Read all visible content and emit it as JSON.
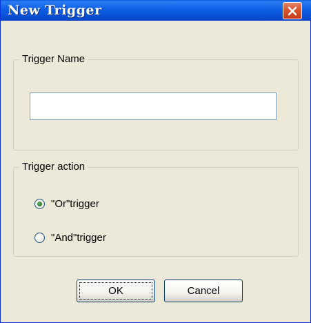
{
  "window": {
    "title": "New Trigger",
    "close_icon": "close-icon"
  },
  "trigger_name": {
    "group_label": "Trigger Name",
    "value": "",
    "placeholder": ""
  },
  "trigger_action": {
    "group_label": "Trigger action",
    "options": [
      {
        "label": "\"Or\"trigger",
        "selected": true
      },
      {
        "label": "\"And\"trigger",
        "selected": false
      }
    ]
  },
  "buttons": {
    "ok": "OK",
    "cancel": "Cancel"
  },
  "colors": {
    "titlebar": "#0A55D8",
    "close": "#D9532D",
    "face": "#ECE9D8",
    "radio_dot": "#2A7A2A"
  }
}
